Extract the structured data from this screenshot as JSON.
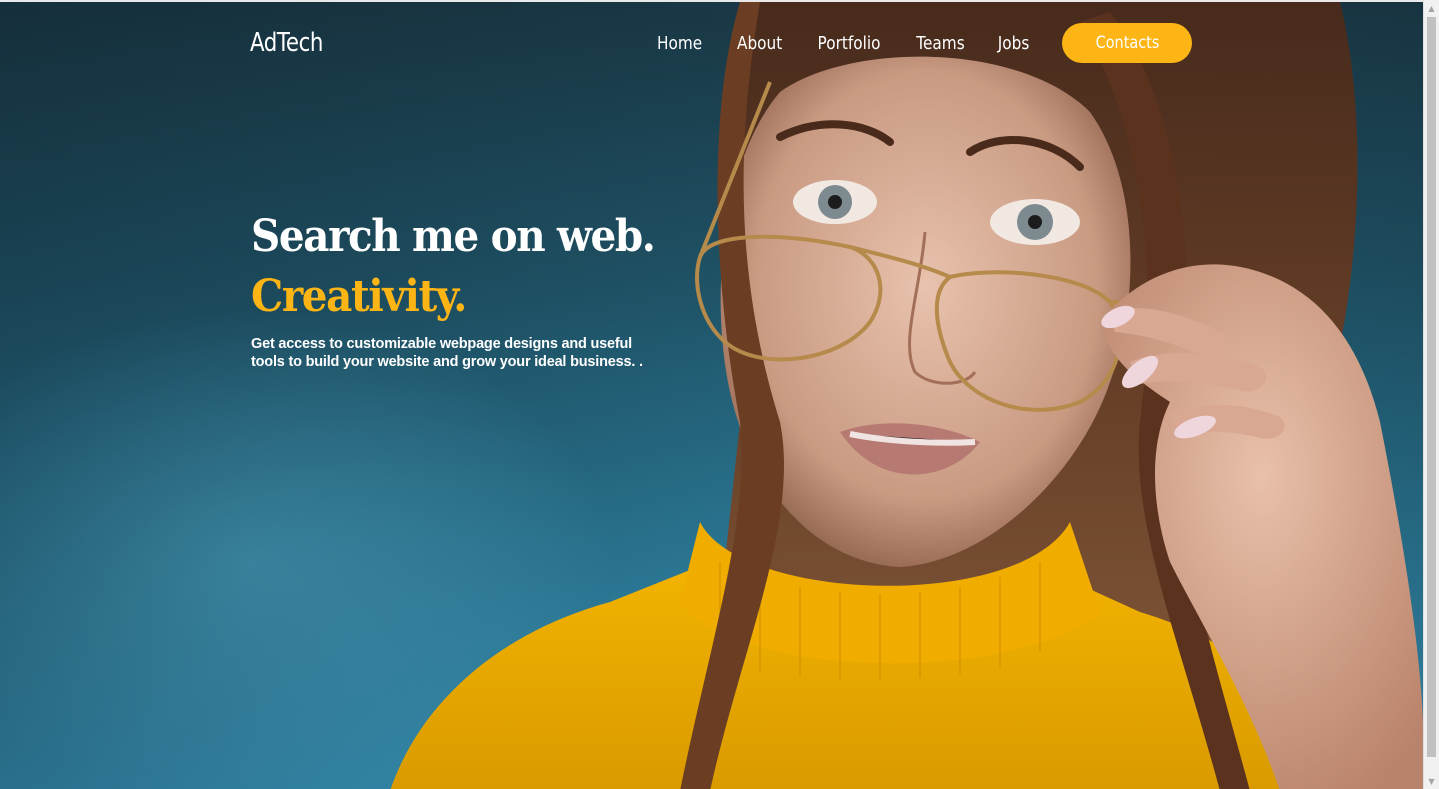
{
  "brand": {
    "name": "AdTech"
  },
  "nav": {
    "links": [
      {
        "label": "Home"
      },
      {
        "label": "About"
      },
      {
        "label": "Portfolio"
      },
      {
        "label": "Teams"
      },
      {
        "label": "Jobs"
      }
    ],
    "cta_label": "Contacts"
  },
  "hero": {
    "headline": "Search me on web.",
    "accent": "Creativity.",
    "subtext": "Get access to customizable webpage designs and useful tools to build your website and grow your ideal business. ."
  },
  "colors": {
    "accent": "#fdb515",
    "background": "#2b7996",
    "text": "#ffffff"
  },
  "icons": {
    "scroll_up": "triangle-up",
    "scroll_down": "triangle-down"
  }
}
